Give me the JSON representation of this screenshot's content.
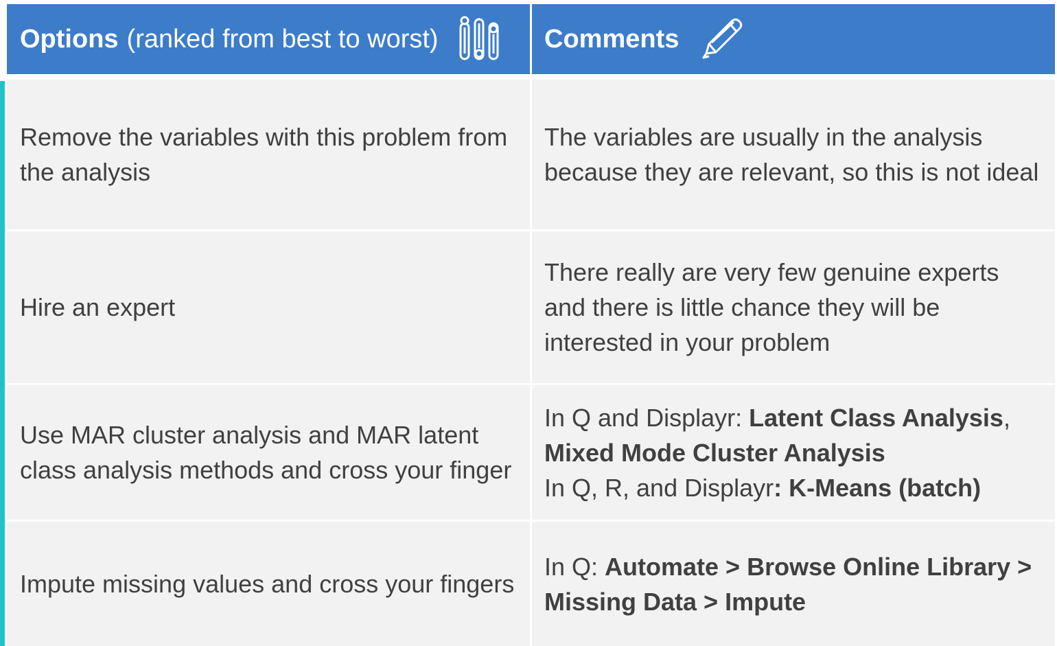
{
  "header": {
    "options_label": "Options",
    "options_sub": "(ranked from best to worst)",
    "options_icon": "sliders-icon",
    "comments_label": "Comments",
    "comments_icon": "pencil-icon",
    "background_color": "#3d7cc9"
  },
  "accent_color": "#1ec3c8",
  "rows": [
    {
      "option": "Remove the variables with this problem from the analysis",
      "comment": "The variables are usually in the analysis because they are relevant, so this is not ideal"
    },
    {
      "option": "Hire an expert",
      "comment": "There really are very few genuine experts and there is little chance they will be interested in your problem"
    },
    {
      "option": "Use MAR cluster analysis and MAR latent class analysis methods and cross your finger",
      "comment_parts": {
        "line1_prefix": "In Q and Displayr: ",
        "line1_bold": "Latent Class Analysis",
        "line1_suffix": ",",
        "line2_bold": "Mixed Mode Cluster Analysis",
        "line3_prefix": "In Q, R, and Displayr",
        "line3_bold": ": K-Means (batch)"
      }
    },
    {
      "option": "Impute missing values and cross your fingers",
      "comment_parts": {
        "prefix": "In Q: ",
        "bold": "Automate > Browse Online Library > Missing Data > Impute"
      }
    }
  ]
}
